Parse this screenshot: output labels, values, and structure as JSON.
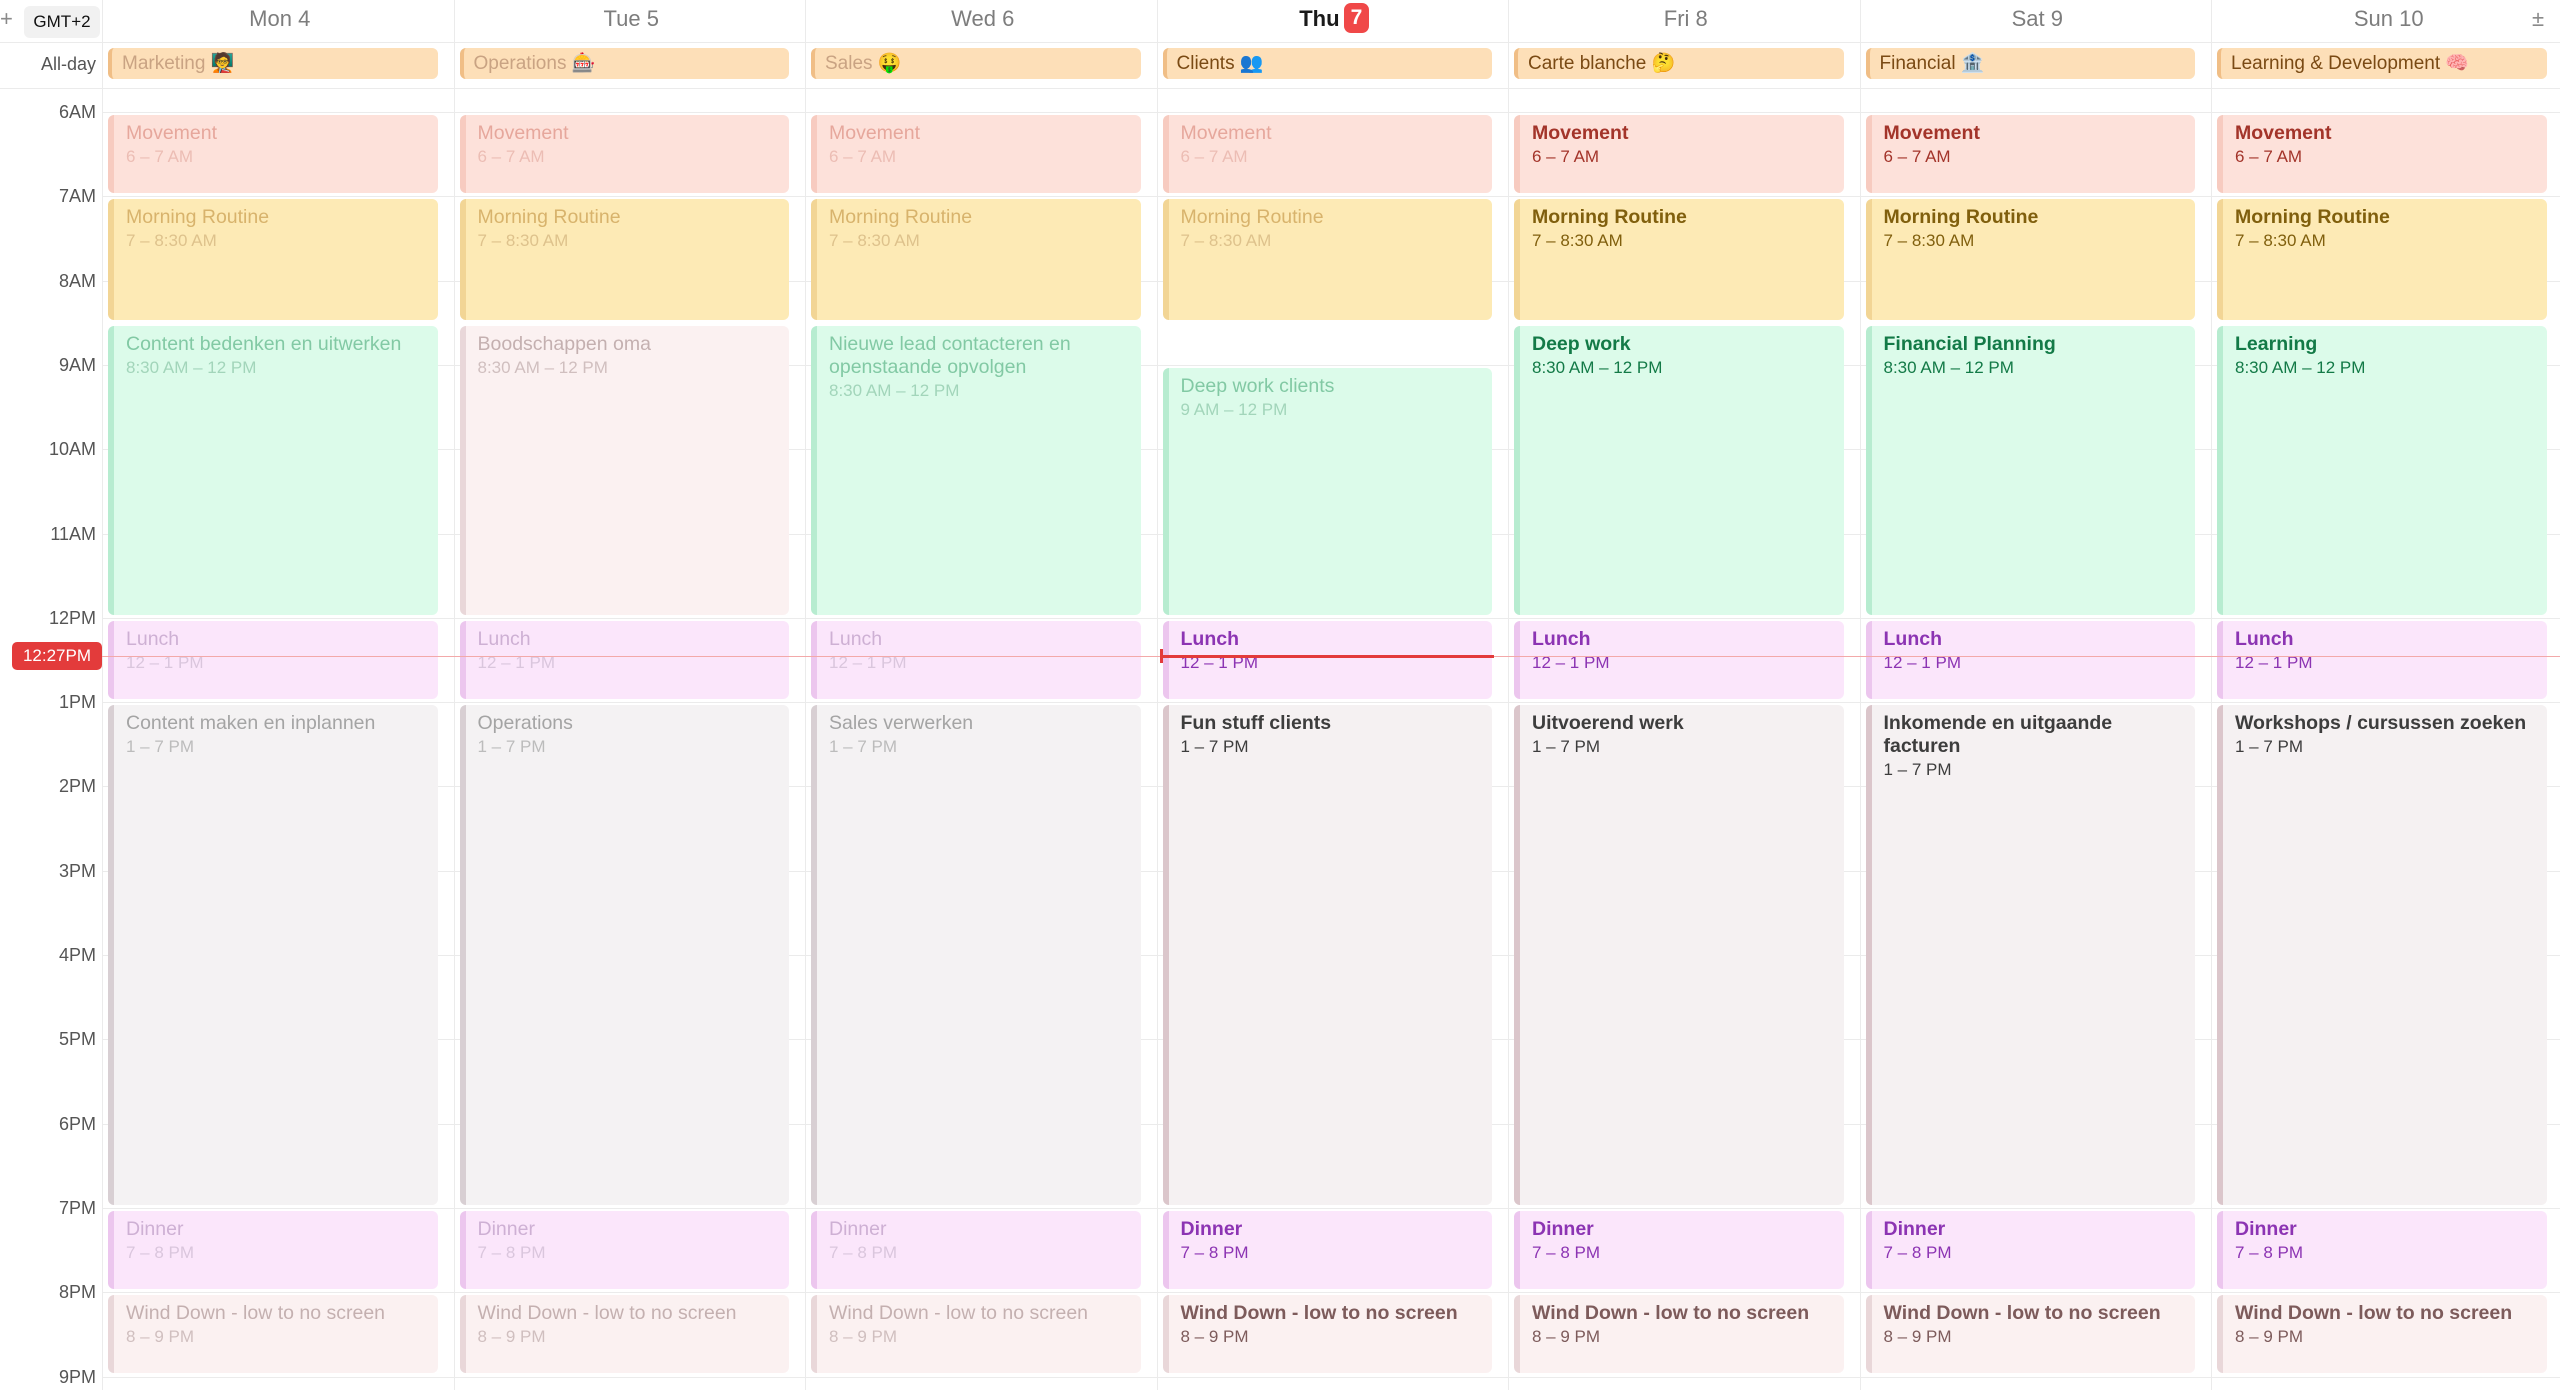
{
  "timezone": "GMT+2",
  "allday_label": "All-day",
  "now_label": "12:27PM",
  "now_hour": 12.45,
  "today_index": 3,
  "hours": [
    "6AM",
    "7AM",
    "8AM",
    "9AM",
    "10AM",
    "11AM",
    "12PM",
    "1PM",
    "2PM",
    "3PM",
    "4PM",
    "5PM",
    "6PM",
    "7PM",
    "8PM",
    "9PM"
  ],
  "palette": {
    "salmon": {
      "bg": "#fde1da",
      "border": "#f7cbc0",
      "text": "#a3342a",
      "faded": "#e6a79c",
      "tfaded": "#ecbdb4"
    },
    "yellow": {
      "bg": "#fdeab5",
      "border": "#f2d595",
      "text": "#805f0d",
      "faded": "#d8b36c",
      "tfaded": "#dec28c"
    },
    "mint": {
      "bg": "#dcfbea",
      "border": "#b7ecd0",
      "text": "#137a47",
      "faded": "#82c9a4",
      "tfaded": "#a2d5ba"
    },
    "pink": {
      "bg": "#fbf1f1",
      "border": "#e9d7d9",
      "text": "#7d5b5b",
      "faded": "#c4b0b0",
      "tfaded": "#d0bfbf"
    },
    "lilac": {
      "bg": "#fbe6fb",
      "border": "#ecc6ee",
      "text": "#8c34b3",
      "faded": "#ceb0d4",
      "tfaded": "#dac6dd"
    },
    "grey": {
      "bg": "#f4f2f3",
      "border": "#d8cfd3",
      "text": "#3d3d3d",
      "faded": "#a4a4a4",
      "tfaded": "#bcbcbc"
    },
    "greyrose": {
      "bg": "#f5f1f2",
      "border": "#dbc6cb",
      "text": "#3d3d3d",
      "faded": "#a4a4a4",
      "tfaded": "#bcbcbc"
    }
  },
  "days": [
    {
      "label": "Mon 4",
      "day_name": "Mon",
      "day_num": "4",
      "allday": "Marketing 🧑‍🏫",
      "past": true,
      "events": [
        {
          "title": "Movement",
          "time": "6 – 7 AM",
          "start": 6,
          "end": 7,
          "color": "salmon"
        },
        {
          "title": "Morning Routine",
          "time": "7 – 8:30 AM",
          "start": 7,
          "end": 8.5,
          "color": "yellow"
        },
        {
          "title": "Content bedenken en uitwerken",
          "time": "8:30 AM – 12 PM",
          "start": 8.5,
          "end": 12,
          "color": "mint"
        },
        {
          "title": "Lunch",
          "time": "12 – 1 PM",
          "start": 12,
          "end": 13,
          "color": "lilac"
        },
        {
          "title": "Content maken en inplannen",
          "time": "1 – 7 PM",
          "start": 13,
          "end": 19,
          "color": "grey"
        },
        {
          "title": "Dinner",
          "time": "7 – 8 PM",
          "start": 19,
          "end": 20,
          "color": "lilac"
        },
        {
          "title": "Wind Down - low to no screen",
          "time": "8 – 9 PM",
          "start": 20,
          "end": 21,
          "color": "pink"
        }
      ]
    },
    {
      "label": "Tue 5",
      "day_name": "Tue",
      "day_num": "5",
      "allday": "Operations 🎰",
      "past": true,
      "events": [
        {
          "title": "Movement",
          "time": "6 – 7 AM",
          "start": 6,
          "end": 7,
          "color": "salmon"
        },
        {
          "title": "Morning Routine",
          "time": "7 – 8:30 AM",
          "start": 7,
          "end": 8.5,
          "color": "yellow"
        },
        {
          "title": "Boodschappen oma",
          "time": "8:30 AM – 12 PM",
          "start": 8.5,
          "end": 12,
          "color": "pink"
        },
        {
          "title": "Lunch",
          "time": "12 – 1 PM",
          "start": 12,
          "end": 13,
          "color": "lilac"
        },
        {
          "title": "Operations",
          "time": "1 – 7 PM",
          "start": 13,
          "end": 19,
          "color": "grey"
        },
        {
          "title": "Dinner",
          "time": "7 – 8 PM",
          "start": 19,
          "end": 20,
          "color": "lilac"
        },
        {
          "title": "Wind Down - low to no screen",
          "time": "8 – 9 PM",
          "start": 20,
          "end": 21,
          "color": "pink"
        }
      ]
    },
    {
      "label": "Wed 6",
      "day_name": "Wed",
      "day_num": "6",
      "allday": "Sales 🤑",
      "past": true,
      "events": [
        {
          "title": "Movement",
          "time": "6 – 7 AM",
          "start": 6,
          "end": 7,
          "color": "salmon"
        },
        {
          "title": "Morning Routine",
          "time": "7 – 8:30 AM",
          "start": 7,
          "end": 8.5,
          "color": "yellow"
        },
        {
          "title": "Nieuwe lead contacteren en openstaande opvolgen",
          "time": "8:30 AM – 12 PM",
          "start": 8.5,
          "end": 12,
          "color": "mint"
        },
        {
          "title": "Lunch",
          "time": "12 – 1 PM",
          "start": 12,
          "end": 13,
          "color": "lilac"
        },
        {
          "title": "Sales verwerken",
          "time": "1 – 7 PM",
          "start": 13,
          "end": 19,
          "color": "grey"
        },
        {
          "title": "Dinner",
          "time": "7 – 8 PM",
          "start": 19,
          "end": 20,
          "color": "lilac"
        },
        {
          "title": "Wind Down - low to no screen",
          "time": "8 – 9 PM",
          "start": 20,
          "end": 21,
          "color": "pink"
        }
      ]
    },
    {
      "label": "Thu 7",
      "day_name": "Thu",
      "day_num": "7",
      "allday": "Clients 👥",
      "past": false,
      "today": true,
      "events": [
        {
          "title": "Movement",
          "time": "6 – 7 AM",
          "start": 6,
          "end": 7,
          "color": "salmon",
          "past": true
        },
        {
          "title": "Morning Routine",
          "time": "7 – 8:30 AM",
          "start": 7,
          "end": 8.5,
          "color": "yellow",
          "past": true
        },
        {
          "title": "Deep work clients",
          "time": "9 AM – 12 PM",
          "start": 9,
          "end": 12,
          "color": "mint",
          "past": true
        },
        {
          "title": "Lunch",
          "time": "12 – 1 PM",
          "start": 12,
          "end": 13,
          "color": "lilac"
        },
        {
          "title": "Fun stuff clients",
          "time": "1 – 7 PM",
          "start": 13,
          "end": 19,
          "color": "greyrose"
        },
        {
          "title": "Dinner",
          "time": "7 – 8 PM",
          "start": 19,
          "end": 20,
          "color": "lilac"
        },
        {
          "title": "Wind Down - low to no screen",
          "time": "8 – 9 PM",
          "start": 20,
          "end": 21,
          "color": "pink"
        }
      ]
    },
    {
      "label": "Fri 8",
      "day_name": "Fri",
      "day_num": "8",
      "allday": "Carte blanche 🤔",
      "past": false,
      "events": [
        {
          "title": "Movement",
          "time": "6 – 7 AM",
          "start": 6,
          "end": 7,
          "color": "salmon"
        },
        {
          "title": "Morning Routine",
          "time": "7 – 8:30 AM",
          "start": 7,
          "end": 8.5,
          "color": "yellow"
        },
        {
          "title": "Deep work",
          "time": "8:30 AM – 12 PM",
          "start": 8.5,
          "end": 12,
          "color": "mint"
        },
        {
          "title": "Lunch",
          "time": "12 – 1 PM",
          "start": 12,
          "end": 13,
          "color": "lilac"
        },
        {
          "title": "Uitvoerend werk",
          "time": "1 – 7 PM",
          "start": 13,
          "end": 19,
          "color": "greyrose"
        },
        {
          "title": "Dinner",
          "time": "7 – 8 PM",
          "start": 19,
          "end": 20,
          "color": "lilac"
        },
        {
          "title": "Wind Down - low to no screen",
          "time": "8 – 9 PM",
          "start": 20,
          "end": 21,
          "color": "pink"
        }
      ]
    },
    {
      "label": "Sat 9",
      "day_name": "Sat",
      "day_num": "9",
      "allday": "Financial 🏦",
      "past": false,
      "events": [
        {
          "title": "Movement",
          "time": "6 – 7 AM",
          "start": 6,
          "end": 7,
          "color": "salmon"
        },
        {
          "title": "Morning Routine",
          "time": "7 – 8:30 AM",
          "start": 7,
          "end": 8.5,
          "color": "yellow"
        },
        {
          "title": "Financial Planning",
          "time": "8:30 AM – 12 PM",
          "start": 8.5,
          "end": 12,
          "color": "mint"
        },
        {
          "title": "Lunch",
          "time": "12 – 1 PM",
          "start": 12,
          "end": 13,
          "color": "lilac"
        },
        {
          "title": "Inkomende en uitgaande facturen",
          "time": "1 – 7 PM",
          "start": 13,
          "end": 19,
          "color": "greyrose"
        },
        {
          "title": "Dinner",
          "time": "7 – 8 PM",
          "start": 19,
          "end": 20,
          "color": "lilac"
        },
        {
          "title": "Wind Down - low to no screen",
          "time": "8 – 9 PM",
          "start": 20,
          "end": 21,
          "color": "pink"
        }
      ]
    },
    {
      "label": "Sun 10",
      "day_name": "Sun",
      "day_num": "10",
      "allday": "Learning & Development 🧠",
      "past": false,
      "events": [
        {
          "title": "Movement",
          "time": "6 – 7 AM",
          "start": 6,
          "end": 7,
          "color": "salmon"
        },
        {
          "title": "Morning Routine",
          "time": "7 – 8:30 AM",
          "start": 7,
          "end": 8.5,
          "color": "yellow"
        },
        {
          "title": "Learning",
          "time": "8:30 AM – 12 PM",
          "start": 8.5,
          "end": 12,
          "color": "mint"
        },
        {
          "title": "Lunch",
          "time": "12 – 1 PM",
          "start": 12,
          "end": 13,
          "color": "lilac"
        },
        {
          "title": "Workshops / cursussen zoeken",
          "time": "1 – 7 PM",
          "start": 13,
          "end": 19,
          "color": "greyrose"
        },
        {
          "title": "Dinner",
          "time": "7 – 8 PM",
          "start": 19,
          "end": 20,
          "color": "lilac"
        },
        {
          "title": "Wind Down - low to no screen",
          "time": "8 – 9 PM",
          "start": 20,
          "end": 21,
          "color": "pink"
        }
      ]
    }
  ]
}
